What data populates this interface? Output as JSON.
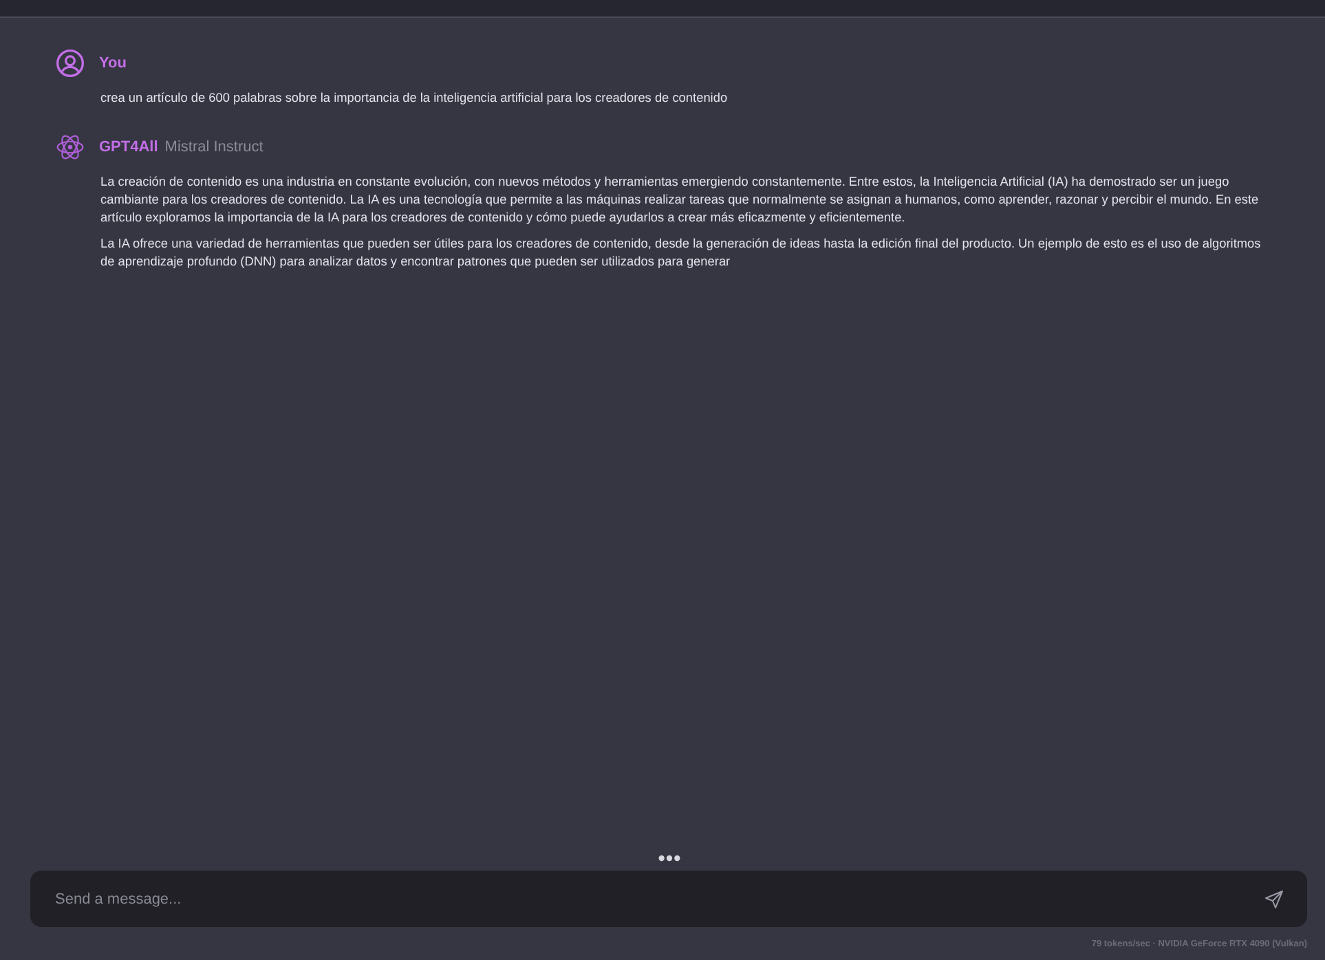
{
  "messages": [
    {
      "kind": "user",
      "author": "You",
      "paragraphs": [
        "crea un artículo de 600 palabras sobre la importancia de la inteligencia artificial para los creadores de contenido"
      ]
    },
    {
      "kind": "assistant",
      "author": "GPT4All",
      "model": "Mistral Instruct",
      "paragraphs": [
        "La creación de contenido es una industria en constante evolución, con nuevos métodos y herramientas emergiendo constantemente. Entre estos, la Inteligencia Artificial (IA) ha demostrado ser un juego cambiante para los creadores de contenido. La IA es una tecnología que permite a las máquinas realizar tareas que normalmente se asignan a humanos, como aprender, razonar y percibir el mundo. En este artículo exploramos la importancia de la IA para los creadores de contenido y cómo puede ayudarlos a crear más eficazmente y eficientemente.",
        "La IA ofrece una variedad de herramientas que pueden ser útiles para los creadores de contenido, desde la generación de ideas hasta la edición final del producto. Un ejemplo de esto es el uso de algoritmos de aprendizaje profundo (DNN) para analizar datos y encontrar patrones que pueden ser utilizados para generar"
      ]
    }
  ],
  "input": {
    "placeholder": "Send a message..."
  },
  "status": "79 tokens/sec · NVIDIA GeForce RTX 4090 (Vulkan)"
}
